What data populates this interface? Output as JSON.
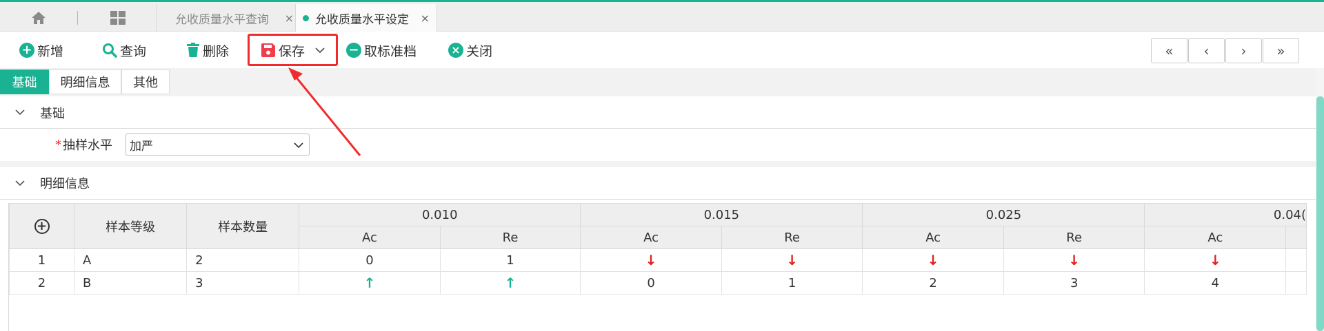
{
  "tabs": {
    "tab1_label": "允收质量水平查询",
    "tab2_label": "允收质量水平设定",
    "close_glyph": "×"
  },
  "toolbar": {
    "new_label": "新增",
    "query_label": "查询",
    "delete_label": "删除",
    "save_label": "保存",
    "cancel_approve_label": "取标准档",
    "close_label": "关闭",
    "nav_first": "«",
    "nav_prev": "‹",
    "nav_next": "›",
    "nav_last": "»"
  },
  "inner_tabs": [
    "基础",
    "明细信息",
    "其他"
  ],
  "sections": {
    "basic_title": "基础",
    "detail_title": "明细信息"
  },
  "form": {
    "required_mark": "*",
    "sampling_label": "抽样水平",
    "sampling_value": "加严"
  },
  "table": {
    "headers": {
      "level": "样本等级",
      "count": "样本数量",
      "groups": [
        "0.010",
        "0.015",
        "0.025",
        "0.04("
      ],
      "ac": "Ac",
      "re": "Re"
    },
    "rows": [
      {
        "idx": "1",
        "level": "A",
        "count": "2",
        "cells": [
          "0",
          "1",
          "↓",
          "↓",
          "↓",
          "↓",
          "↓"
        ]
      },
      {
        "idx": "2",
        "level": "B",
        "count": "3",
        "cells": [
          "↑",
          "↑",
          "0",
          "1",
          "2",
          "3",
          "4"
        ]
      }
    ]
  },
  "colors": {
    "accent": "#19b394",
    "highlight_red": "#f02b2b",
    "down_arrow": "#e01f1f"
  }
}
